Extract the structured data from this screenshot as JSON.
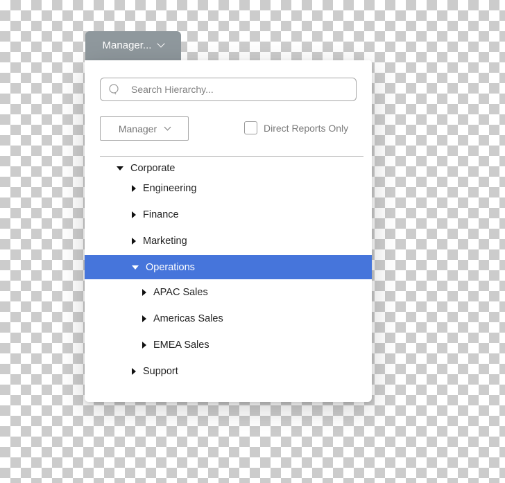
{
  "trigger": {
    "label": "Manager...",
    "icon": "chevron-down-icon"
  },
  "search": {
    "placeholder": "Search Hierarchy...",
    "value": "",
    "icon": "search-icon"
  },
  "filter": {
    "select_label": "Manager",
    "select_icon": "chevron-down-icon",
    "checkbox_label": "Direct Reports Only",
    "checkbox_checked": false
  },
  "tree": {
    "nodes": [
      {
        "label": "Corporate",
        "level": 0,
        "expanded": true,
        "selected": false
      },
      {
        "label": "Engineering",
        "level": 1,
        "expanded": false,
        "selected": false
      },
      {
        "label": "Finance",
        "level": 1,
        "expanded": false,
        "selected": false
      },
      {
        "label": "Marketing",
        "level": 1,
        "expanded": false,
        "selected": false
      },
      {
        "label": "Operations",
        "level": 1,
        "expanded": true,
        "selected": true
      },
      {
        "label": "APAC Sales",
        "level": 2,
        "expanded": false,
        "selected": false
      },
      {
        "label": "Americas Sales",
        "level": 2,
        "expanded": false,
        "selected": false
      },
      {
        "label": "EMEA Sales",
        "level": 2,
        "expanded": false,
        "selected": false
      },
      {
        "label": "Support",
        "level": 1,
        "expanded": false,
        "selected": false
      }
    ]
  },
  "colors": {
    "selected": "#4675db",
    "trigger": "#8f989d"
  }
}
